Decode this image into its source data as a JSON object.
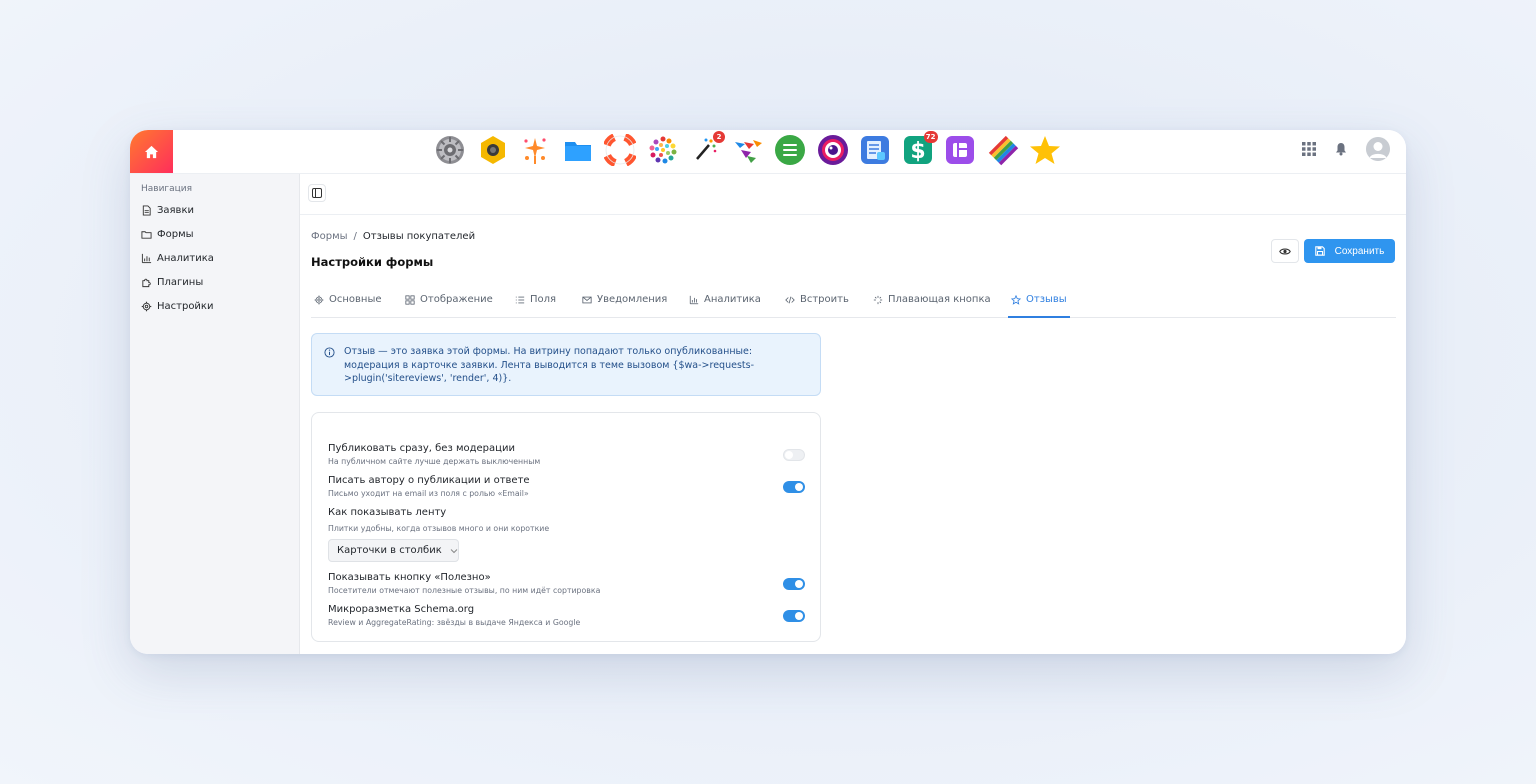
{
  "topbar": {
    "apps": [
      {
        "icon": "gear-app-icon"
      },
      {
        "icon": "hexagon-camera-app-icon"
      },
      {
        "icon": "sparkles-app-icon"
      },
      {
        "icon": "folder-app-icon"
      },
      {
        "icon": "lifebuoy-app-icon"
      },
      {
        "icon": "color-dots-app-icon"
      },
      {
        "icon": "magic-wand-app-icon",
        "badge": "2"
      },
      {
        "icon": "paper-planes-app-icon"
      },
      {
        "icon": "menu-list-app-icon"
      },
      {
        "icon": "camera-lens-app-icon"
      },
      {
        "icon": "document-app-icon"
      },
      {
        "icon": "dollar-app-icon",
        "badge": "72"
      },
      {
        "icon": "layout-app-icon"
      },
      {
        "icon": "stripes-app-icon"
      },
      {
        "icon": "star-app-icon"
      }
    ]
  },
  "sidebar": {
    "title": "Навигация",
    "items": [
      {
        "label": "Заявки",
        "icon": "document-icon"
      },
      {
        "label": "Формы",
        "icon": "folder-icon"
      },
      {
        "label": "Аналитика",
        "icon": "chart-icon"
      },
      {
        "label": "Плагины",
        "icon": "puzzle-icon"
      },
      {
        "label": "Настройки",
        "icon": "gear-icon"
      }
    ]
  },
  "breadcrumb": {
    "parent": "Формы",
    "separator": "/",
    "current": "Отзывы покупателей"
  },
  "page": {
    "title": "Настройки формы",
    "save_label": "Сохранить"
  },
  "tabs": [
    {
      "label": "Основные",
      "icon": "gear-icon"
    },
    {
      "label": "Отображение",
      "icon": "grid-icon"
    },
    {
      "label": "Поля",
      "icon": "list-icon"
    },
    {
      "label": "Уведомления",
      "icon": "mail-icon"
    },
    {
      "label": "Аналитика",
      "icon": "chart-icon"
    },
    {
      "label": "Встроить",
      "icon": "code-icon"
    },
    {
      "label": "Плавающая кнопка",
      "icon": "sparkle-icon"
    },
    {
      "label": "Отзывы",
      "icon": "star-icon",
      "active": true
    }
  ],
  "info": {
    "text": "Отзыв — это заявка этой формы. На витрину попадают только опубликованные: модерация в карточке заявки. Лента выводится в теме вызовом {$wa->requests->plugin('sitereviews', 'render', 4)}."
  },
  "settings": {
    "publish": {
      "title": "Публиковать сразу, без модерации",
      "desc": "На публичном сайте лучше держать выключенным",
      "enabled": false
    },
    "notify": {
      "title": "Писать автору о публикации и ответе",
      "desc": "Письмо уходит на email из поля с ролью «Email»",
      "enabled": true
    },
    "feed": {
      "title": "Как показывать ленту",
      "desc": "Плитки удобны, когда отзывов много и они короткие",
      "selected": "Карточки в столбик"
    },
    "helpful": {
      "title": "Показывать кнопку «Полезно»",
      "desc": "Посетители отмечают полезные отзывы, по ним идёт сортировка",
      "enabled": true
    },
    "schema": {
      "title": "Микроразметка Schema.org",
      "desc": "Review и AggregateRating: звёзды в выдаче Яндекса и Google",
      "enabled": true
    }
  },
  "colors": {
    "accent": "#2f95ef",
    "home": "#ff4d4d"
  }
}
